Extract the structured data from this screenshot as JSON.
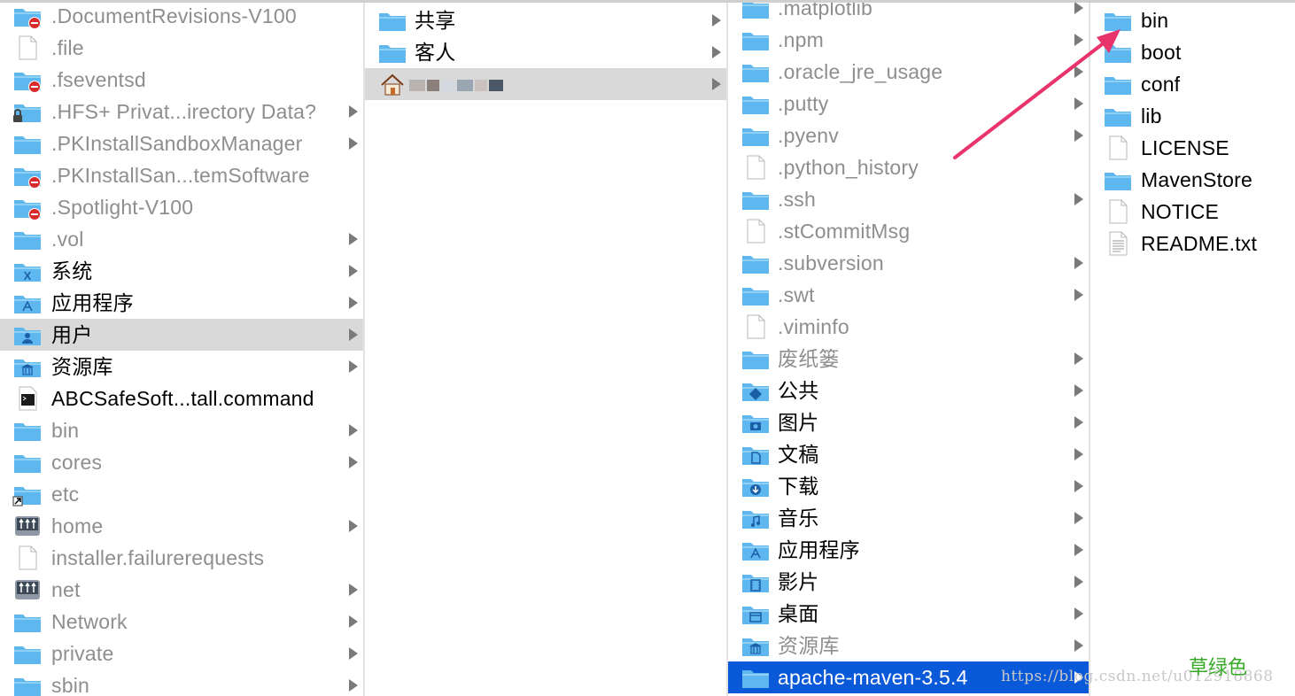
{
  "columns": [
    {
      "items": [
        {
          "label": ".DocumentRevisions-V100",
          "icon": "folder-restricted-icon",
          "dim": true,
          "arrow": false
        },
        {
          "label": ".file",
          "icon": "document-icon",
          "dim": true,
          "arrow": false
        },
        {
          "label": ".fseventsd",
          "icon": "folder-restricted-icon",
          "dim": true,
          "arrow": false
        },
        {
          "label": ".HFS+ Privat...irectory Data?",
          "icon": "folder-locked-icon",
          "dim": true,
          "arrow": true
        },
        {
          "label": ".PKInstallSandboxManager",
          "icon": "folder-icon",
          "dim": true,
          "arrow": true
        },
        {
          "label": ".PKInstallSan...temSoftware",
          "icon": "folder-restricted-icon",
          "dim": true,
          "arrow": false
        },
        {
          "label": ".Spotlight-V100",
          "icon": "folder-restricted-icon",
          "dim": true,
          "arrow": false
        },
        {
          "label": ".vol",
          "icon": "folder-icon",
          "dim": true,
          "arrow": true
        },
        {
          "label": "系统",
          "icon": "system-folder-icon",
          "dim": false,
          "arrow": true
        },
        {
          "label": "应用程序",
          "icon": "applications-folder-icon",
          "dim": false,
          "arrow": true
        },
        {
          "label": "用户",
          "icon": "users-folder-icon",
          "dim": false,
          "arrow": true,
          "selected": "gray"
        },
        {
          "label": "资源库",
          "icon": "library-folder-icon",
          "dim": false,
          "arrow": true
        },
        {
          "label": "ABCSafeSoft...tall.command",
          "icon": "terminal-command-icon",
          "dim": false,
          "arrow": false
        },
        {
          "label": "bin",
          "icon": "folder-icon",
          "dim": true,
          "arrow": true
        },
        {
          "label": "cores",
          "icon": "folder-icon",
          "dim": true,
          "arrow": true
        },
        {
          "label": "etc",
          "icon": "folder-alias-icon",
          "dim": true,
          "arrow": false
        },
        {
          "label": "home",
          "icon": "network-drive-icon",
          "dim": true,
          "arrow": true
        },
        {
          "label": "installer.failurerequests",
          "icon": "document-icon",
          "dim": true,
          "arrow": false
        },
        {
          "label": "net",
          "icon": "network-drive-icon",
          "dim": true,
          "arrow": true
        },
        {
          "label": "Network",
          "icon": "folder-icon",
          "dim": true,
          "arrow": true
        },
        {
          "label": "private",
          "icon": "folder-icon",
          "dim": true,
          "arrow": true
        },
        {
          "label": "sbin",
          "icon": "folder-icon",
          "dim": true,
          "arrow": true
        }
      ]
    },
    {
      "items": [
        {
          "label": "共享",
          "icon": "folder-icon",
          "dim": false,
          "arrow": true
        },
        {
          "label": "客人",
          "icon": "folder-icon",
          "dim": false,
          "arrow": true
        },
        {
          "label": "",
          "icon": "home-icon",
          "dim": false,
          "arrow": true,
          "selected": "gray",
          "redacted": true
        }
      ]
    },
    {
      "items": [
        {
          "label": ".matplotlib",
          "icon": "folder-icon",
          "dim": true,
          "arrow": true
        },
        {
          "label": ".npm",
          "icon": "folder-icon",
          "dim": true,
          "arrow": true
        },
        {
          "label": ".oracle_jre_usage",
          "icon": "folder-icon",
          "dim": true,
          "arrow": true
        },
        {
          "label": ".putty",
          "icon": "folder-icon",
          "dim": true,
          "arrow": true
        },
        {
          "label": ".pyenv",
          "icon": "folder-icon",
          "dim": true,
          "arrow": true
        },
        {
          "label": ".python_history",
          "icon": "document-icon",
          "dim": true,
          "arrow": false
        },
        {
          "label": ".ssh",
          "icon": "folder-icon",
          "dim": true,
          "arrow": true
        },
        {
          "label": ".stCommitMsg",
          "icon": "document-icon",
          "dim": true,
          "arrow": false
        },
        {
          "label": ".subversion",
          "icon": "folder-icon",
          "dim": true,
          "arrow": true
        },
        {
          "label": ".swt",
          "icon": "folder-icon",
          "dim": true,
          "arrow": true
        },
        {
          "label": ".viminfo",
          "icon": "document-icon",
          "dim": true,
          "arrow": false
        },
        {
          "label": "废纸篓",
          "icon": "folder-icon",
          "dim": true,
          "arrow": true
        },
        {
          "label": "公共",
          "icon": "public-folder-icon",
          "dim": false,
          "arrow": true
        },
        {
          "label": "图片",
          "icon": "pictures-folder-icon",
          "dim": false,
          "arrow": true
        },
        {
          "label": "文稿",
          "icon": "documents-folder-icon",
          "dim": false,
          "arrow": true
        },
        {
          "label": "下载",
          "icon": "downloads-folder-icon",
          "dim": false,
          "arrow": true
        },
        {
          "label": "音乐",
          "icon": "music-folder-icon",
          "dim": false,
          "arrow": true
        },
        {
          "label": "应用程序",
          "icon": "applications-folder-icon",
          "dim": false,
          "arrow": true
        },
        {
          "label": "影片",
          "icon": "movies-folder-icon",
          "dim": false,
          "arrow": true
        },
        {
          "label": "桌面",
          "icon": "desktop-folder-icon",
          "dim": false,
          "arrow": true
        },
        {
          "label": "资源库",
          "icon": "library-folder-icon",
          "dim": true,
          "arrow": true
        },
        {
          "label": "apache-maven-3.5.4",
          "icon": "folder-icon",
          "dim": false,
          "arrow": true,
          "selected": "blue"
        }
      ]
    },
    {
      "items": [
        {
          "label": "bin",
          "icon": "folder-icon",
          "dim": false,
          "arrow": false
        },
        {
          "label": "boot",
          "icon": "folder-icon",
          "dim": false,
          "arrow": false
        },
        {
          "label": "conf",
          "icon": "folder-icon",
          "dim": false,
          "arrow": false
        },
        {
          "label": "lib",
          "icon": "folder-icon",
          "dim": false,
          "arrow": false
        },
        {
          "label": "LICENSE",
          "icon": "document-icon",
          "dim": false,
          "arrow": false
        },
        {
          "label": "MavenStore",
          "icon": "folder-icon",
          "dim": false,
          "arrow": false
        },
        {
          "label": "NOTICE",
          "icon": "document-icon",
          "dim": false,
          "arrow": false
        },
        {
          "label": "README.txt",
          "icon": "text-document-icon",
          "dim": false,
          "arrow": false
        }
      ]
    }
  ],
  "watermark": "https://blog.csdn.net/u012918868",
  "brand_text": "草绿色",
  "colors": {
    "folder": "#5fb7ee",
    "selection_blue": "#0a59d8",
    "selection_gray": "#d9d9d9",
    "annotation_arrow": "#e8336b",
    "brand_green": "#3aaa2a"
  }
}
